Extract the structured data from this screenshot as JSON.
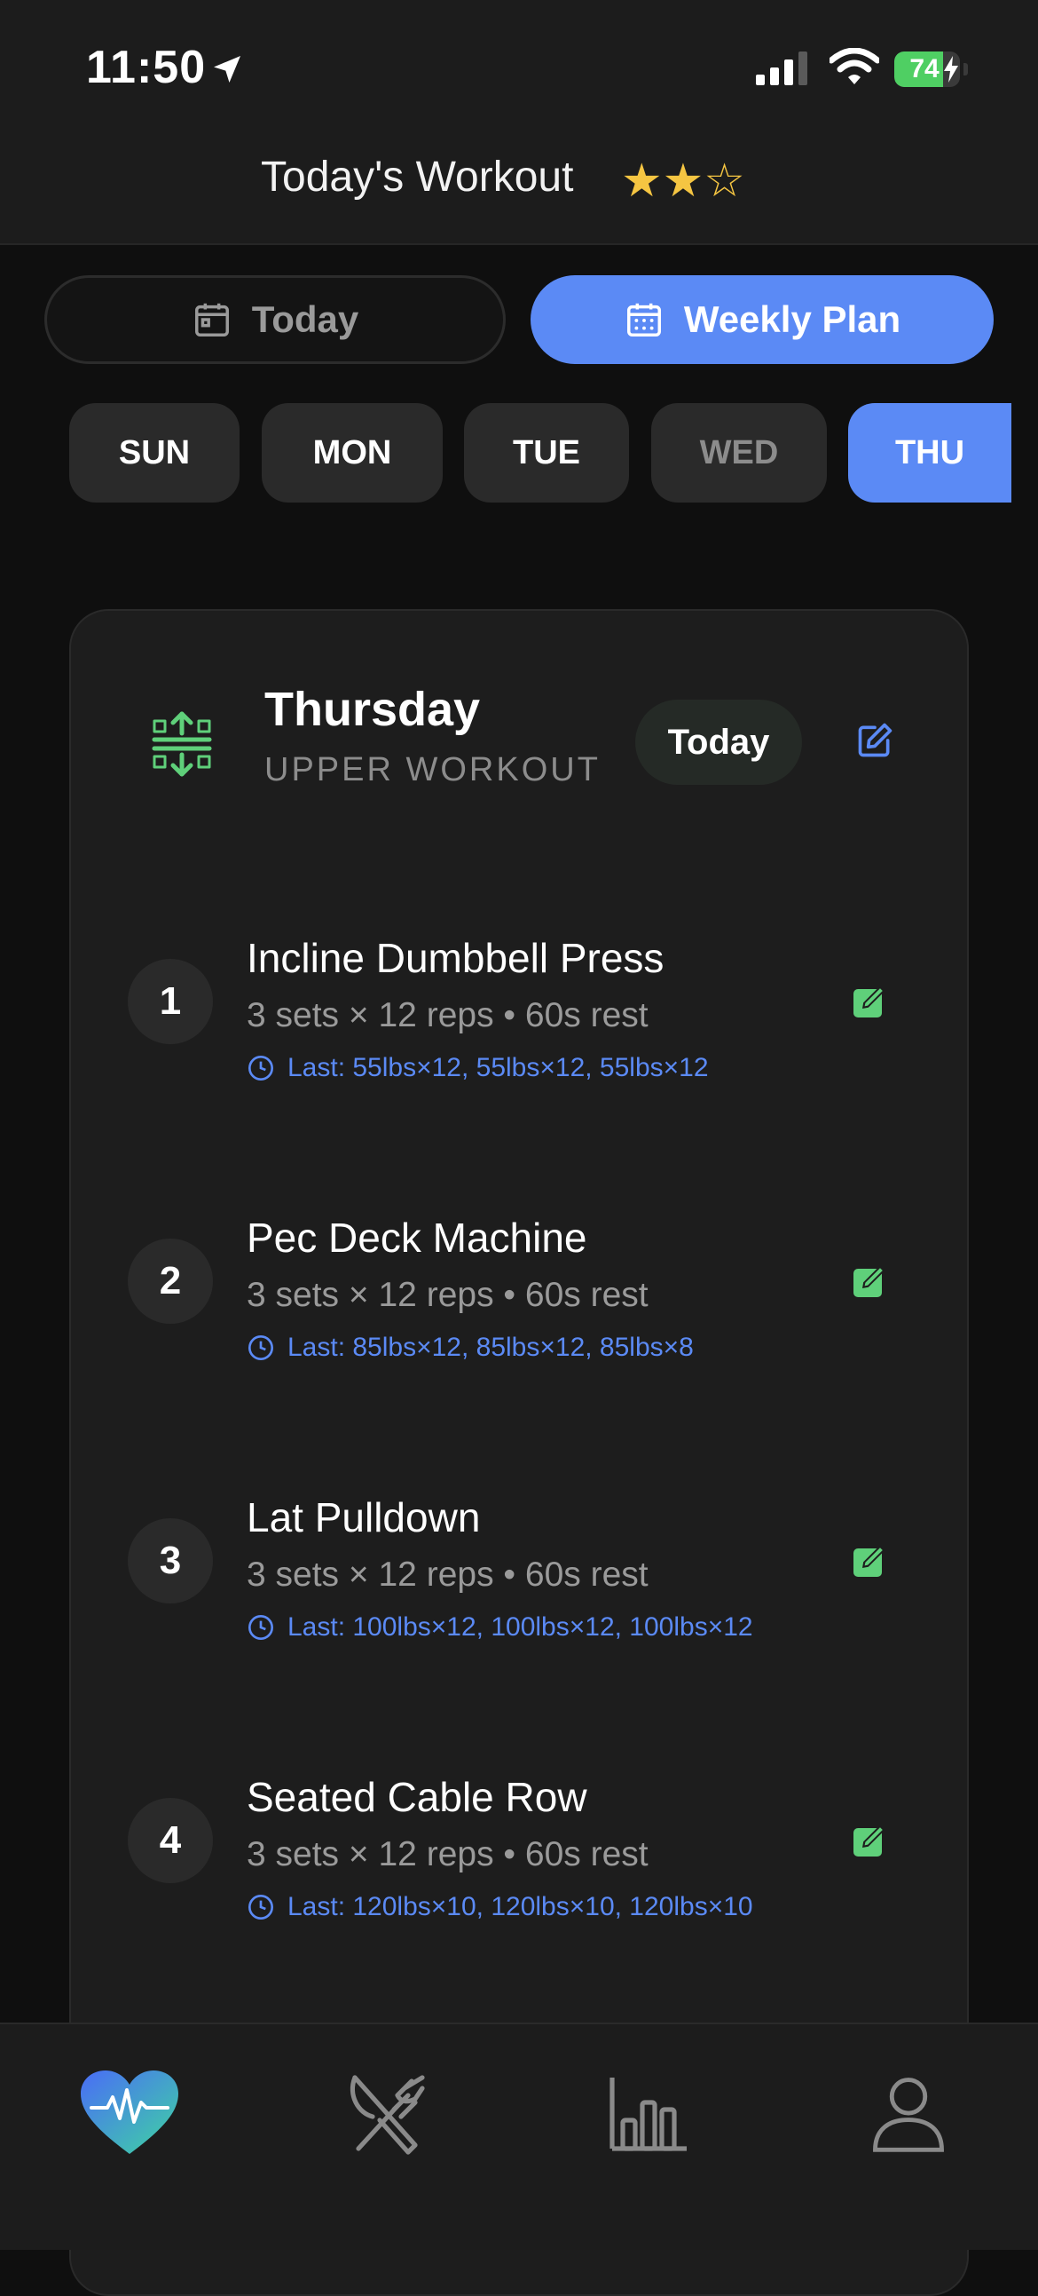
{
  "status_bar": {
    "time": "11:50",
    "battery": "74",
    "battery_level": 0.74
  },
  "header": {
    "title": "Today's Workout",
    "rating": 2,
    "rating_max": 3
  },
  "mode_tabs": {
    "today": "Today",
    "weekly": "Weekly Plan",
    "active": "weekly"
  },
  "days": [
    {
      "label": "SUN",
      "state": "normal"
    },
    {
      "label": "MON",
      "state": "normal"
    },
    {
      "label": "TUE",
      "state": "normal"
    },
    {
      "label": "WED",
      "state": "muted"
    },
    {
      "label": "THU",
      "state": "active"
    }
  ],
  "card": {
    "day": "Thursday",
    "subtitle": "UPPER WORKOUT",
    "badge": "Today",
    "exercises": [
      {
        "num": "1",
        "name": "Incline Dumbbell Press",
        "detail": "3 sets × 12 reps • 60s rest",
        "last": "Last: 55lbs×12, 55lbs×12, 55lbs×12"
      },
      {
        "num": "2",
        "name": "Pec Deck Machine",
        "detail": "3 sets × 12 reps • 60s rest",
        "last": "Last: 85lbs×12, 85lbs×12, 85lbs×8"
      },
      {
        "num": "3",
        "name": "Lat Pulldown",
        "detail": "3 sets × 12 reps • 60s rest",
        "last": "Last: 100lbs×12, 100lbs×12, 100lbs×12"
      },
      {
        "num": "4",
        "name": "Seated Cable Row",
        "detail": "3 sets × 12 reps • 60s rest",
        "last": "Last: 120lbs×10, 120lbs×10, 120lbs×10"
      }
    ]
  },
  "tab_bar": {
    "items": [
      {
        "icon": "heart-pulse-icon",
        "active": true
      },
      {
        "icon": "fork-knife-icon",
        "active": false
      },
      {
        "icon": "bar-chart-icon",
        "active": false
      },
      {
        "icon": "person-icon",
        "active": false
      }
    ]
  },
  "colors": {
    "accent": "#5b8af5",
    "green": "#5fd07a",
    "star": "#f5c542",
    "background": "#0f0f0f",
    "card": "#1d1d1d"
  }
}
